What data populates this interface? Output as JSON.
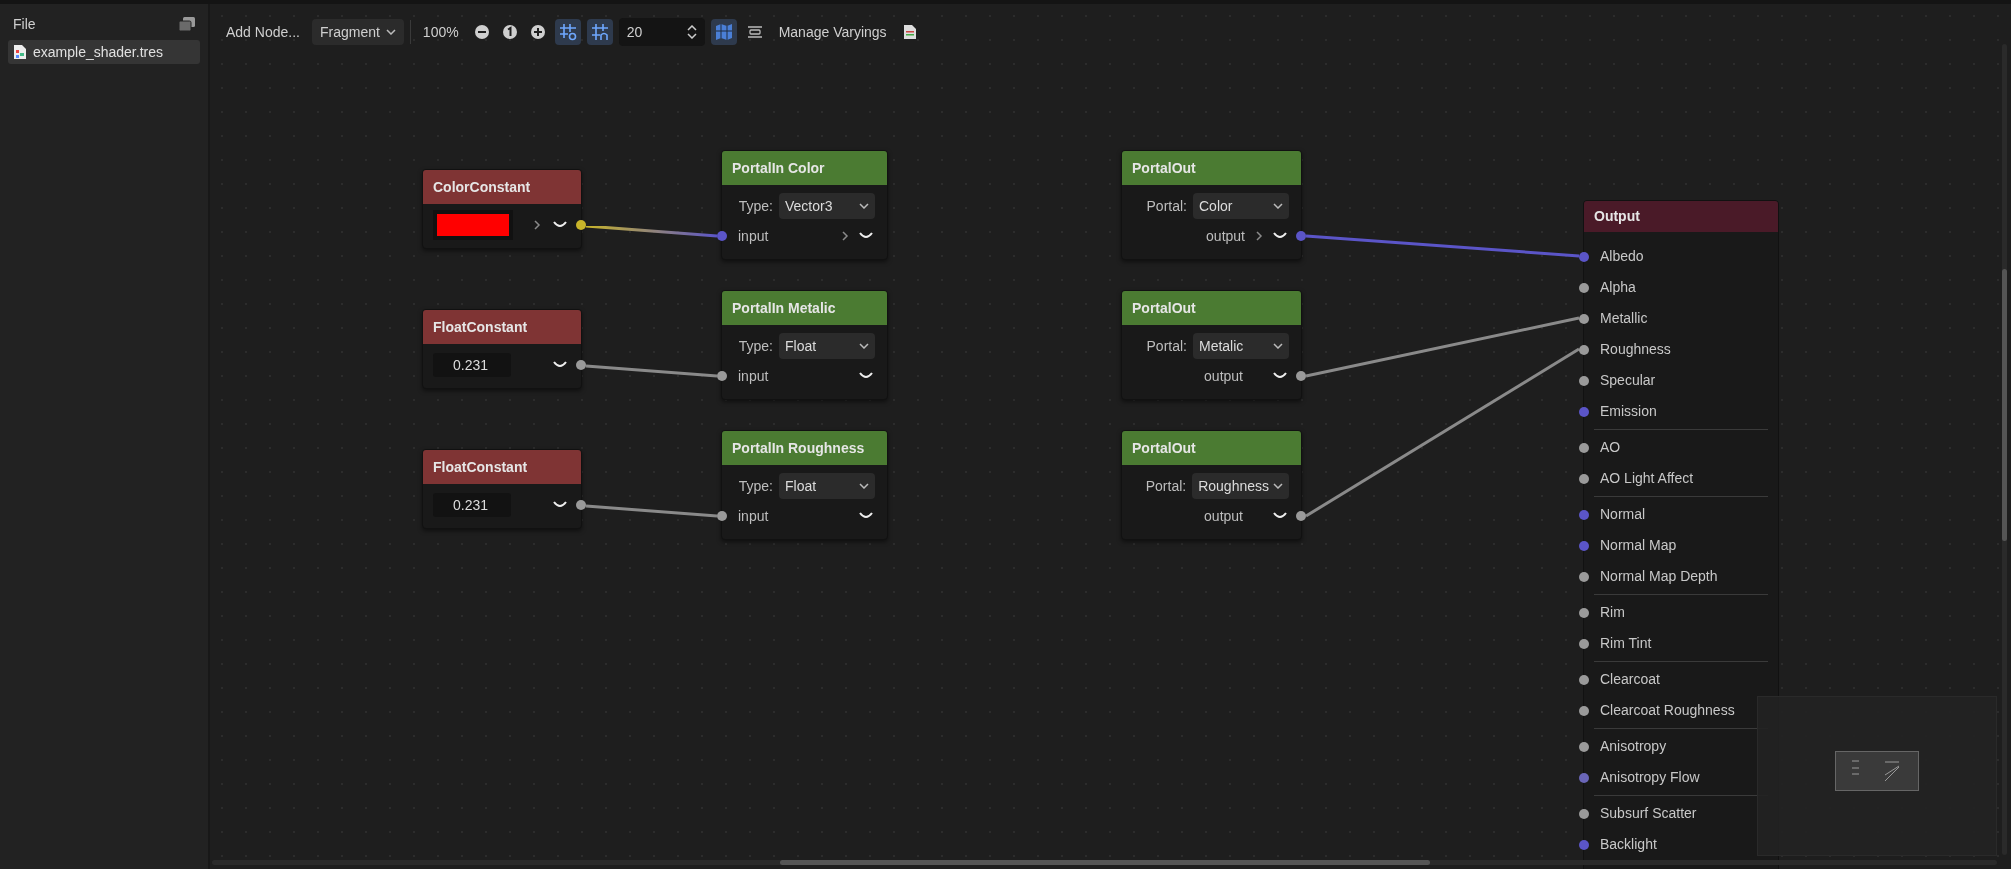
{
  "sidebar": {
    "title": "File",
    "files": [
      {
        "name": "example_shader.tres",
        "selected": true
      }
    ]
  },
  "toolbar": {
    "add_node": "Add Node...",
    "shader_mode": "Fragment",
    "zoom": "100%",
    "snap_enabled": true,
    "grid_visible": true,
    "snap_distance": "20",
    "minimap_visible": true,
    "manage_varyings": "Manage Varyings"
  },
  "graph": {
    "nodes": [
      {
        "kind": "color_constant",
        "title": "ColorConstant",
        "swatch": {
          "color": "#ff0000"
        },
        "expandable": true,
        "port_dot": {
          "color": "#c8b42a"
        }
      },
      {
        "kind": "float_constant",
        "title": "FloatConstant",
        "value": "0.231",
        "expandable": false,
        "port_dot": {
          "color": "#9a9a9a"
        }
      },
      {
        "kind": "float_constant",
        "title": "FloatConstant",
        "value": "0.231",
        "expandable": false,
        "port_dot": {
          "color": "#9a9a9a"
        }
      },
      {
        "kind": "portal_in",
        "title": "PortalIn Color",
        "label": "Type:",
        "option": "Vector3",
        "port": "input",
        "expandable": true,
        "port_dot": {
          "color": "#5b55c8"
        }
      },
      {
        "kind": "portal_in",
        "title": "PortalIn Metalic",
        "label": "Type:",
        "option": "Float",
        "port": "input",
        "expandable": false,
        "port_dot": {
          "color": "#9a9a9a"
        }
      },
      {
        "kind": "portal_in",
        "title": "PortalIn Roughness",
        "label": "Type:",
        "option": "Float",
        "port": "input",
        "expandable": false,
        "port_dot": {
          "color": "#9a9a9a"
        }
      },
      {
        "kind": "portal_out",
        "title": "PortalOut",
        "label": "Portal:",
        "option": "Color",
        "port": "output",
        "expandable": true,
        "port_dot": {
          "color": "#5b55c8"
        }
      },
      {
        "kind": "portal_out",
        "title": "PortalOut",
        "label": "Portal:",
        "option": "Metalic",
        "port": "output",
        "expandable": false,
        "port_dot": {
          "color": "#9a9a9a"
        }
      },
      {
        "kind": "portal_out",
        "title": "PortalOut",
        "label": "Portal:",
        "option": "Roughness",
        "port": "output",
        "expandable": false,
        "port_dot": {
          "color": "#9a9a9a"
        }
      }
    ],
    "output": {
      "title": "Output",
      "groups": [
        [
          {
            "name": "Albedo",
            "color": "#5b55c8"
          },
          {
            "name": "Alpha",
            "color": "#9a9a9a"
          },
          {
            "name": "Metallic",
            "color": "#9a9a9a"
          },
          {
            "name": "Roughness",
            "color": "#9a9a9a"
          },
          {
            "name": "Specular",
            "color": "#9a9a9a"
          },
          {
            "name": "Emission",
            "color": "#5b55c8"
          }
        ],
        [
          {
            "name": "AO",
            "color": "#9a9a9a"
          },
          {
            "name": "AO Light Affect",
            "color": "#9a9a9a"
          }
        ],
        [
          {
            "name": "Normal",
            "color": "#5b55c8"
          },
          {
            "name": "Normal Map",
            "color": "#5b55c8"
          },
          {
            "name": "Normal Map Depth",
            "color": "#9a9a9a"
          }
        ],
        [
          {
            "name": "Rim",
            "color": "#9a9a9a"
          },
          {
            "name": "Rim Tint",
            "color": "#9a9a9a"
          }
        ],
        [
          {
            "name": "Clearcoat",
            "color": "#9a9a9a"
          },
          {
            "name": "Clearcoat Roughness",
            "color": "#9a9a9a"
          }
        ],
        [
          {
            "name": "Anisotropy",
            "color": "#9a9a9a"
          },
          {
            "name": "Anisotropy Flow",
            "color": "#6a66b8"
          }
        ],
        [
          {
            "name": "Subsurf Scatter",
            "color": "#9a9a9a"
          },
          {
            "name": "Backlight",
            "color": "#5b55c8"
          }
        ]
      ]
    }
  }
}
